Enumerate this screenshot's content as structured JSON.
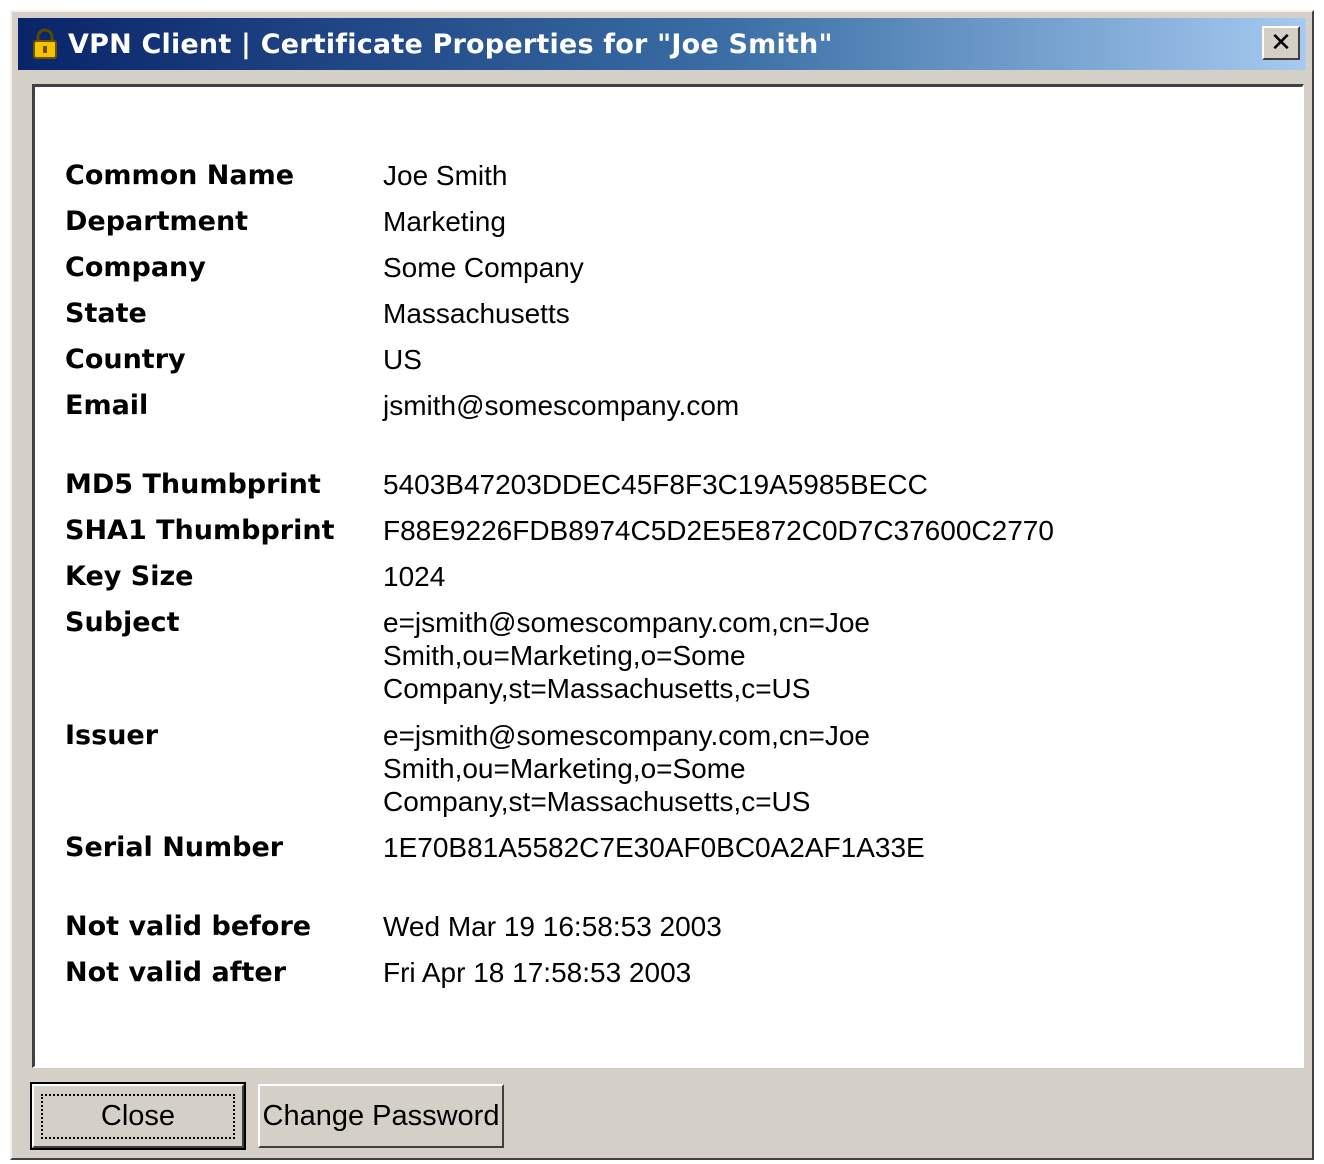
{
  "window": {
    "title": "VPN Client  |  Certificate Properties for \"Joe Smith\"",
    "close_glyph": "✕",
    "icon": "lock-icon"
  },
  "fields": {
    "common_name": {
      "label": "Common Name",
      "value": "Joe Smith"
    },
    "department": {
      "label": "Department",
      "value": "Marketing"
    },
    "company": {
      "label": "Company",
      "value": "Some Company"
    },
    "state": {
      "label": "State",
      "value": "Massachusetts"
    },
    "country": {
      "label": "Country",
      "value": "US"
    },
    "email": {
      "label": "Email",
      "value": "jsmith@somescompany.com"
    },
    "md5": {
      "label": "MD5 Thumbprint",
      "value": "5403B47203DDEC45F8F3C19A5985BECC"
    },
    "sha1": {
      "label": "SHA1 Thumbprint",
      "value": "F88E9226FDB8974C5D2E5E872C0D7C37600C2770"
    },
    "key_size": {
      "label": "Key Size",
      "value": "1024"
    },
    "subject": {
      "label": "Subject",
      "lines": [
        "e=jsmith@somescompany.com,cn=Joe",
        "Smith,ou=Marketing,o=Some",
        "Company,st=Massachusetts,c=US"
      ]
    },
    "issuer": {
      "label": "Issuer",
      "lines": [
        "e=jsmith@somescompany.com,cn=Joe",
        "Smith,ou=Marketing,o=Some",
        "Company,st=Massachusetts,c=US"
      ]
    },
    "serial": {
      "label": "Serial Number",
      "value": "1E70B81A5582C7E30AF0BC0A2AF1A33E"
    },
    "not_before": {
      "label": "Not valid before",
      "value": "Wed Mar 19 16:58:53 2003"
    },
    "not_after": {
      "label": "Not valid after",
      "value": "Fri Apr 18 17:58:53 2003"
    }
  },
  "buttons": {
    "close": "Close",
    "change_password": "Change Password"
  },
  "colors": {
    "title_start": "#0a246a",
    "title_end": "#a6caf0",
    "face": "#d4d0c8"
  }
}
